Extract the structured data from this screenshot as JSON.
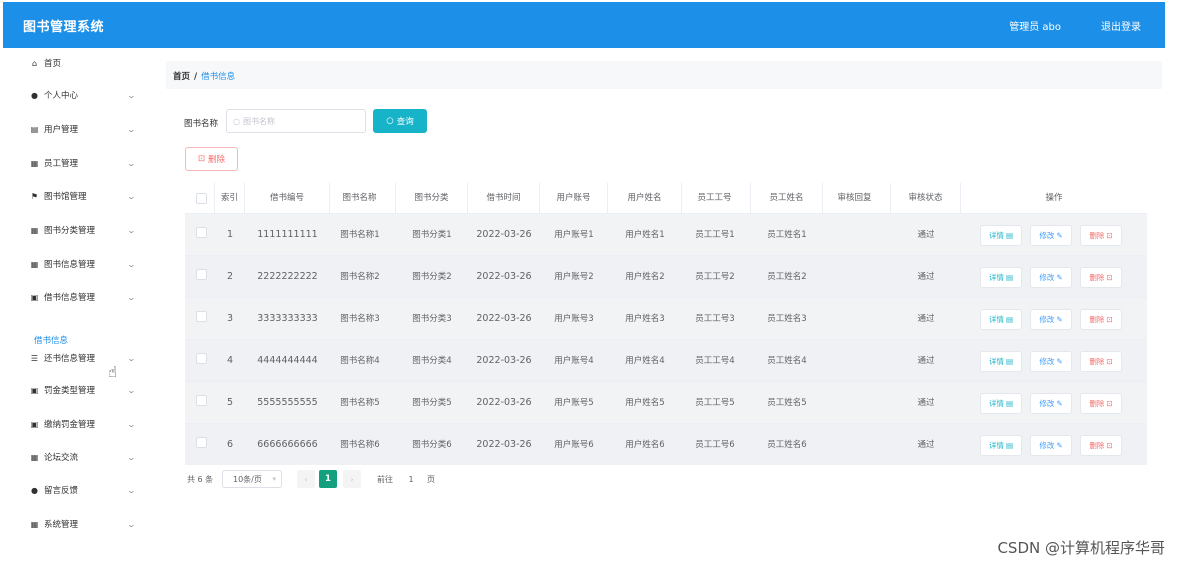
{
  "header": {
    "title": "图书管理系统",
    "user_label": "管理员 abo",
    "logout_label": "退出登录"
  },
  "sidebar": {
    "items": [
      {
        "label": "首页",
        "icon": "home-icon",
        "glyph": "⌂",
        "has_children": false
      },
      {
        "label": "个人中心",
        "icon": "user-icon",
        "glyph": "●",
        "has_children": true
      },
      {
        "label": "用户管理",
        "icon": "user-manage-icon",
        "glyph": "▤",
        "has_children": true
      },
      {
        "label": "员工管理",
        "icon": "grid-icon",
        "glyph": "▦",
        "has_children": true
      },
      {
        "label": "图书馆管理",
        "icon": "flag-icon",
        "glyph": "⚑",
        "has_children": true
      },
      {
        "label": "图书分类管理",
        "icon": "grid-icon",
        "glyph": "▦",
        "has_children": true
      },
      {
        "label": "图书信息管理",
        "icon": "grid-icon",
        "glyph": "▦",
        "has_children": true
      },
      {
        "label": "借书信息管理",
        "icon": "doc-icon",
        "glyph": "▣",
        "has_children": true
      },
      {
        "label": "还书信息管理",
        "icon": "list-icon",
        "glyph": "☰",
        "has_children": true
      },
      {
        "label": "罚金类型管理",
        "icon": "doc-icon",
        "glyph": "▣",
        "has_children": true
      },
      {
        "label": "缴纳罚金管理",
        "icon": "doc-icon",
        "glyph": "▣",
        "has_children": true
      },
      {
        "label": "论坛交流",
        "icon": "grid-icon",
        "glyph": "▦",
        "has_children": true
      },
      {
        "label": "留言反馈",
        "icon": "user-icon",
        "glyph": "●",
        "has_children": true
      },
      {
        "label": "系统管理",
        "icon": "grid-icon",
        "glyph": "▦",
        "has_children": true
      }
    ],
    "active_sub": "借书信息"
  },
  "breadcrumb": {
    "home": "首页",
    "separator": "/",
    "current": "借书信息"
  },
  "search": {
    "label": "图书名称",
    "placeholder": "图书名称",
    "button_label": "查询"
  },
  "delete_button_label": "删除",
  "table": {
    "headers": [
      "索引",
      "借书编号",
      "图书名称",
      "图书分类",
      "借书时间",
      "用户账号",
      "用户姓名",
      "员工工号",
      "员工姓名",
      "审核回复",
      "审核状态",
      "操作"
    ],
    "rows": [
      {
        "index": "1",
        "borrow_no": "1111111111",
        "book_name": "图书名称1",
        "category": "图书分类1",
        "time": "2022-03-26",
        "account": "用户账号1",
        "user_name": "用户姓名1",
        "emp_no": "员工工号1",
        "emp_name": "员工姓名1",
        "reply": "",
        "status": "通过"
      },
      {
        "index": "2",
        "borrow_no": "2222222222",
        "book_name": "图书名称2",
        "category": "图书分类2",
        "time": "2022-03-26",
        "account": "用户账号2",
        "user_name": "用户姓名2",
        "emp_no": "员工工号2",
        "emp_name": "员工姓名2",
        "reply": "",
        "status": "通过"
      },
      {
        "index": "3",
        "borrow_no": "3333333333",
        "book_name": "图书名称3",
        "category": "图书分类3",
        "time": "2022-03-26",
        "account": "用户账号3",
        "user_name": "用户姓名3",
        "emp_no": "员工工号3",
        "emp_name": "员工姓名3",
        "reply": "",
        "status": "通过"
      },
      {
        "index": "4",
        "borrow_no": "4444444444",
        "book_name": "图书名称4",
        "category": "图书分类4",
        "time": "2022-03-26",
        "account": "用户账号4",
        "user_name": "用户姓名4",
        "emp_no": "员工工号4",
        "emp_name": "员工姓名4",
        "reply": "",
        "status": "通过"
      },
      {
        "index": "5",
        "borrow_no": "5555555555",
        "book_name": "图书名称5",
        "category": "图书分类5",
        "time": "2022-03-26",
        "account": "用户账号5",
        "user_name": "用户姓名5",
        "emp_no": "员工工号5",
        "emp_name": "员工姓名5",
        "reply": "",
        "status": "通过"
      },
      {
        "index": "6",
        "borrow_no": "6666666666",
        "book_name": "图书名称6",
        "category": "图书分类6",
        "time": "2022-03-26",
        "account": "用户账号6",
        "user_name": "用户姓名6",
        "emp_no": "员工工号6",
        "emp_name": "员工姓名6",
        "reply": "",
        "status": "通过"
      }
    ],
    "actions": {
      "view": "详情",
      "edit": "修改",
      "delete": "删除"
    }
  },
  "pagination": {
    "total": "共 6 条",
    "page_size": "10条/页",
    "current_page": "1",
    "goto_prefix": "前往",
    "goto_value": "1",
    "goto_suffix": "页"
  },
  "watermark": "CSDN @计算机程序华哥",
  "colors": {
    "header": "#1c8fe8",
    "search_button": "#17b3c9",
    "danger": "#f56c6c",
    "pager_active": "#13a07e"
  }
}
